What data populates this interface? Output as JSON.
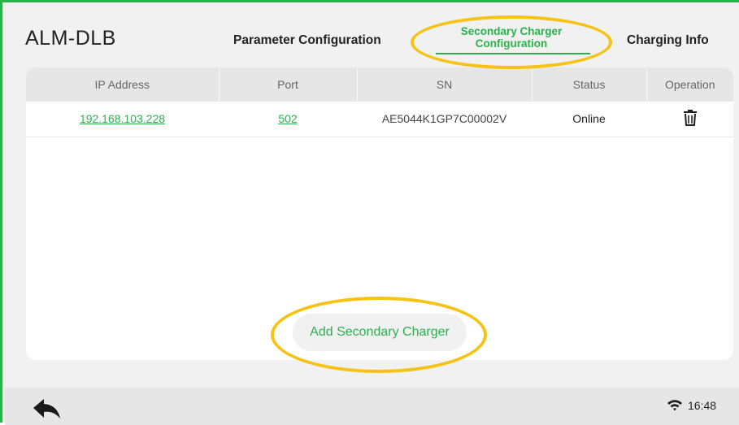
{
  "header": {
    "app_title": "ALM-DLB",
    "tabs": [
      {
        "label": "Parameter Configuration",
        "active": false
      },
      {
        "label": "Secondary Charger Configuration",
        "active": true
      },
      {
        "label": "Charging Info",
        "active": false
      }
    ]
  },
  "table": {
    "columns": [
      "IP Address",
      "Port",
      "SN",
      "Status",
      "Operation"
    ],
    "rows": [
      {
        "ip": "192.168.103.228",
        "port": "502",
        "sn": "AE5044K1GP7C00002V",
        "status": "Online",
        "operation_icon": "trash-icon"
      }
    ]
  },
  "actions": {
    "add_label": "Add Secondary Charger"
  },
  "status_bar": {
    "time": "16:48",
    "wifi_icon": "wifi-icon",
    "back_icon": "back-arrow-icon"
  },
  "colors": {
    "accent": "#2bb24c",
    "highlight_ring": "#f6c315"
  }
}
